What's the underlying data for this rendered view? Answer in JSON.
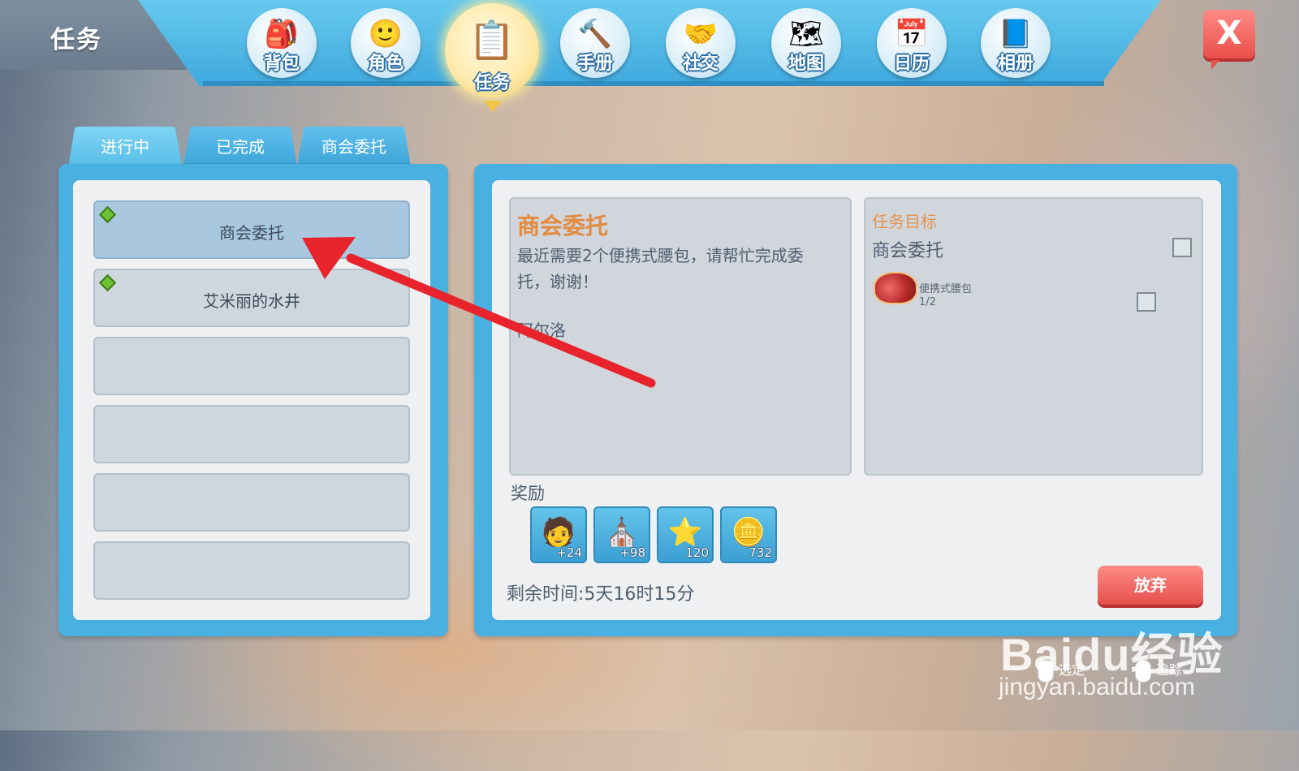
{
  "header": {
    "title": "任务",
    "close_label": "X"
  },
  "nav": {
    "items": [
      {
        "label": "背包",
        "icon": "backpack-icon",
        "glyph": "🎒"
      },
      {
        "label": "角色",
        "icon": "character-icon",
        "glyph": "🙂"
      },
      {
        "label": "任务",
        "icon": "quest-clipboard-icon",
        "glyph": "📋",
        "active": true
      },
      {
        "label": "手册",
        "icon": "hammer-icon",
        "glyph": "🔨"
      },
      {
        "label": "社交",
        "icon": "handshake-icon",
        "glyph": "🤝"
      },
      {
        "label": "地图",
        "icon": "map-icon",
        "glyph": "🗺"
      },
      {
        "label": "日历",
        "icon": "calendar-icon",
        "glyph": "📅"
      },
      {
        "label": "相册",
        "icon": "album-icon",
        "glyph": "📘"
      }
    ]
  },
  "tabs": [
    {
      "label": "进行中",
      "active": true
    },
    {
      "label": "已完成"
    },
    {
      "label": "商会委托"
    }
  ],
  "quest_list": [
    {
      "label": "商会委托",
      "selected": true,
      "marker": true
    },
    {
      "label": "艾米丽的水井",
      "marker": true
    },
    {
      "label": ""
    },
    {
      "label": ""
    },
    {
      "label": ""
    },
    {
      "label": ""
    }
  ],
  "detail": {
    "title": "商会委托",
    "description": "最近需要2个便携式腰包，请帮忙完成委托，谢谢！",
    "npc": "阿尔洛",
    "goal_heading": "任务目标",
    "goal_name": "商会委托",
    "goal_item_name": "便携式腰包",
    "goal_item_progress": "1/2",
    "reward_label": "奖励",
    "rewards": [
      {
        "icon": "npc-portrait-icon",
        "glyph": "🧑",
        "count": "+24"
      },
      {
        "icon": "church-icon",
        "glyph": "⛪",
        "count": "+98"
      },
      {
        "icon": "exp-star-icon",
        "glyph": "⭐",
        "count": "120"
      },
      {
        "icon": "gold-coin-icon",
        "glyph": "🪙",
        "count": "732"
      }
    ],
    "time_left": "剩余时间:5天16时15分",
    "abandon_label": "放弃"
  },
  "hints": {
    "select_label": "选定",
    "track_label": "追踪"
  },
  "watermark": {
    "logo": "Baidu经验",
    "url": "jingyan.baidu.com"
  },
  "colors": {
    "accent_blue": "#49b0e2",
    "title_orange": "#e48a3e",
    "danger_red": "#e5504c",
    "arrow_red": "#e8232b"
  }
}
